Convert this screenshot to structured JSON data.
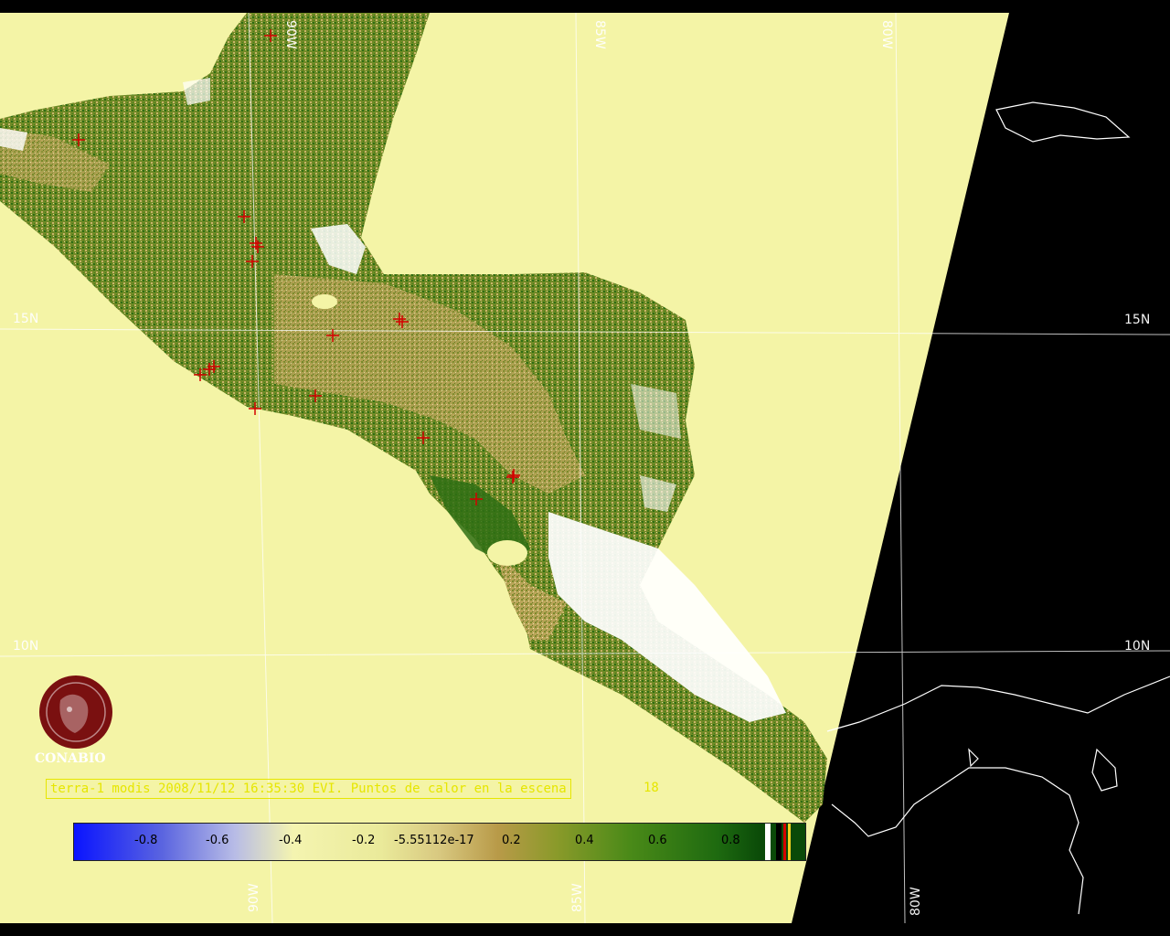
{
  "colors": {
    "background": "#000000",
    "swath": "#f4f4a6",
    "land_dark": "#2e6e14",
    "land_mid": "#7a8a2a",
    "land_light": "#c9b36a",
    "cloud": "#ffffff",
    "gridline": "#ffffff",
    "caption": "#e6e600",
    "marker": "#d40000",
    "logo": "#7a1010"
  },
  "grid_labels": {
    "lon_90w_top": "90W",
    "lon_85w_top": "85W",
    "lon_80w_top": "80W",
    "lon_90w_bottom": "90W",
    "lon_85w_bottom": "85W",
    "lon_80w_bottom": "80W",
    "lat_15n_left": "15N",
    "lat_15n_right": "15N",
    "lat_10n_left": "10N",
    "lat_10n_right": "10N"
  },
  "caption": {
    "text": "terra-1 modis 2008/11/12 16:35:30 EVI. Puntos de calor en la escena",
    "count": "18"
  },
  "colorbar": {
    "ticks": [
      "-0.8",
      "-0.6",
      "-0.4",
      "-0.2",
      "-5.55112e-17",
      "0.2",
      "0.4",
      "0.6",
      "0.8"
    ],
    "range": [
      -1,
      1
    ]
  },
  "logo": {
    "text": "CONABIO",
    "icon": "conabio-logo-icon"
  },
  "hotspots": {
    "count": 18,
    "icon": "fire-crosshair-icon"
  }
}
